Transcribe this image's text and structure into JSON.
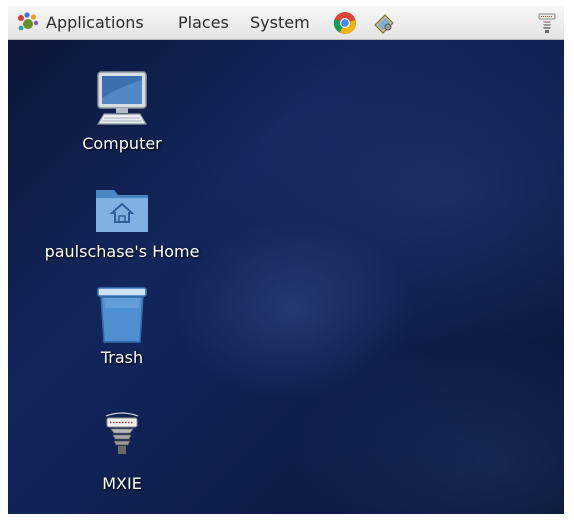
{
  "panel": {
    "menus": {
      "applications": "Applications",
      "places": "Places",
      "system": "System"
    },
    "launchers": [
      "chrome-icon",
      "screenshot-tool-icon"
    ],
    "tray_icon": "mxie-tray-icon"
  },
  "desktop": {
    "icons": [
      {
        "label": "Computer",
        "icon": "computer-icon"
      },
      {
        "label": "paulschase's Home",
        "icon": "home-folder-icon"
      },
      {
        "label": "Trash",
        "icon": "trash-icon"
      },
      {
        "label": "MXIE",
        "icon": "mxie-icon"
      }
    ]
  },
  "colors": {
    "panel_bg": "#ececec",
    "desktop_bg": "#13265c",
    "label_text": "#ffffff"
  }
}
